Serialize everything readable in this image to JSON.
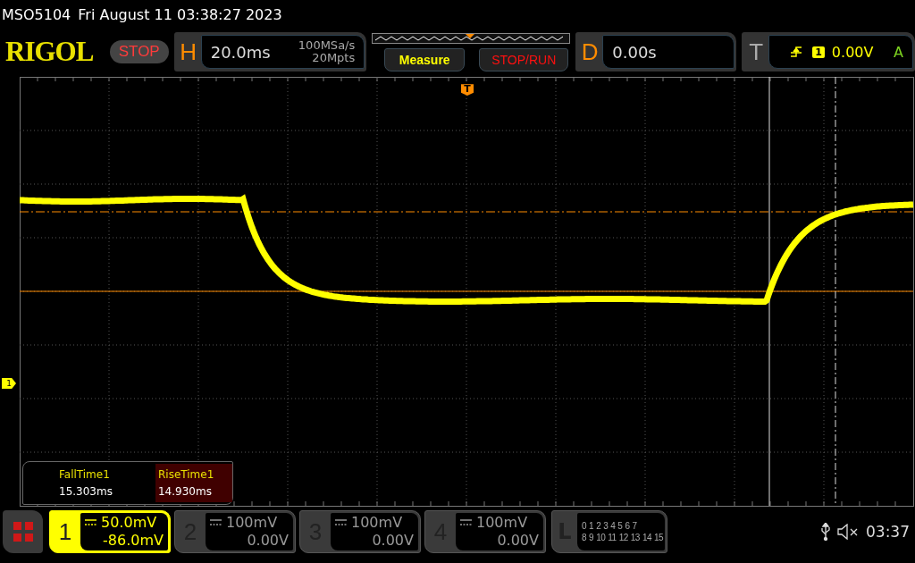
{
  "header": {
    "model": "MSO5104",
    "datetime": "Fri August 11 03:38:27 2023"
  },
  "toolbar": {
    "logo": "RIGOL",
    "run_state": "STOP",
    "horizontal": {
      "label": "H",
      "timebase": "20.0ms",
      "sample_rate": "100MSa/s",
      "memory_depth": "20Mpts"
    },
    "buttons": [
      {
        "label": "Measure",
        "kind": "measure"
      },
      {
        "label": "STOP/RUN",
        "kind": "run"
      }
    ],
    "delay": {
      "label": "D",
      "value": "0.00s"
    },
    "trigger": {
      "label": "T",
      "channel": "1",
      "level": "0.00V",
      "mode": "A"
    }
  },
  "display": {
    "trigger_marker": "T",
    "channel_marker": "1"
  },
  "measurements": [
    {
      "name": "FallTime1",
      "value": "15.303ms",
      "selected": false
    },
    {
      "name": "RiseTime1",
      "value": "14.930ms",
      "selected": true
    }
  ],
  "channels": [
    {
      "number": "1",
      "scale": "50.0mV",
      "offset": "-86.0mV",
      "on": true
    },
    {
      "number": "2",
      "scale": "100mV",
      "offset": "0.00V",
      "on": false
    },
    {
      "number": "3",
      "scale": "100mV",
      "offset": "0.00V",
      "on": false
    },
    {
      "number": "4",
      "scale": "100mV",
      "offset": "0.00V",
      "on": false
    }
  ],
  "logic": {
    "label": "L",
    "row_1": [
      "0",
      "1",
      "2",
      "3",
      "4",
      "5",
      "6",
      "7"
    ],
    "row_2": [
      "8",
      "9",
      "10",
      "11",
      "12",
      "13",
      "14",
      "15"
    ]
  },
  "status": {
    "time": "03:37"
  }
}
